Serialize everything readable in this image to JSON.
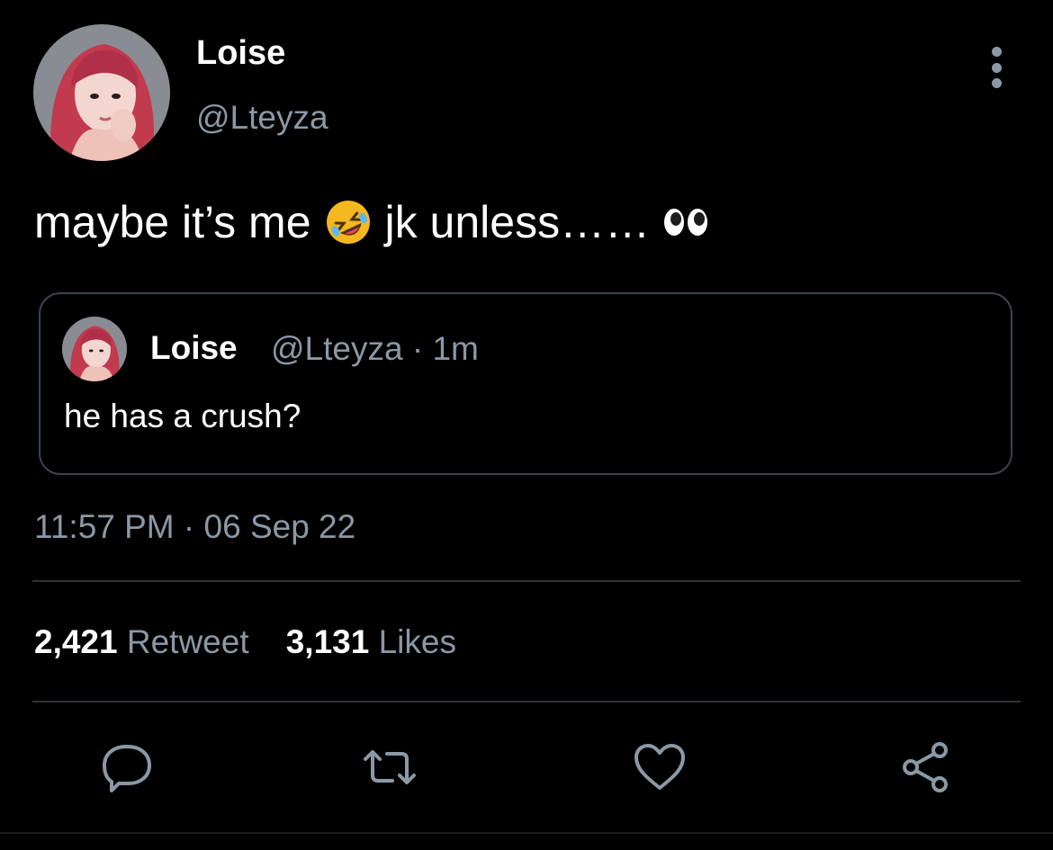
{
  "author": {
    "display_name": "Loise",
    "handle": "@Lteyza",
    "avatar_icon": "profile-photo"
  },
  "tweet": {
    "text_before_emoji": "maybe it’s me",
    "emoji_1": "rolling-on-floor-laughing-emoji",
    "text_middle": "jk unless……",
    "emoji_2": "eyes-emoji"
  },
  "quote": {
    "display_name": "Loise",
    "meta": "@Lteyza · 1m",
    "text": "he has a crush?"
  },
  "timestamp": "11:57 PM · 06 Sep 22",
  "stats": {
    "retweets_count": "2,421",
    "retweets_label": "Retweet",
    "likes_count": "3,131",
    "likes_label": "Likes"
  },
  "actions": [
    "reply-icon",
    "retweet-icon",
    "like-icon",
    "share-icon"
  ],
  "colors": {
    "background": "#000000",
    "text": "#ffffff",
    "muted": "#8b98a5",
    "border": "#38444d"
  }
}
